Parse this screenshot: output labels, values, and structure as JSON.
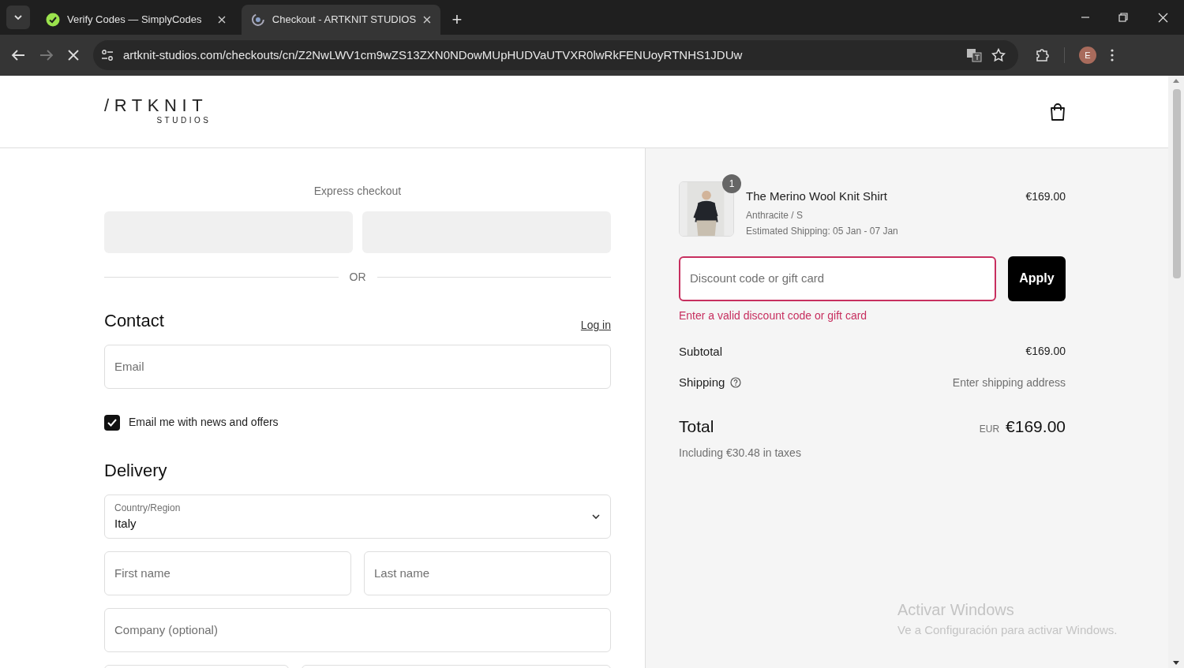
{
  "browser": {
    "tabs": [
      {
        "title": "Verify Codes — SimplyCodes",
        "selected": false,
        "kind": "check"
      },
      {
        "title": "Checkout - ARTKNIT STUDIOS",
        "selected": true,
        "kind": "loading"
      }
    ],
    "new_tab": "+",
    "address": "artknit-studios.com/checkouts/cn/Z2NwLWV1cm9wZS13ZXN0NDowMUpHUDVaUTVXR0lwRkFENUoyRTNHS1JDUw",
    "profile": "E"
  },
  "header": {
    "logo": "/RTKNIT",
    "logo_sub": "STUDIOS"
  },
  "checkout": {
    "express": {
      "title": "Express checkout",
      "divider": "OR"
    },
    "contact": {
      "title": "Contact",
      "login": "Log in",
      "email_placeholder": "Email",
      "newsletter": {
        "label": "Email me with news and offers",
        "checked": true
      }
    },
    "delivery": {
      "title": "Delivery",
      "country": {
        "label": "Country/Region",
        "value": "Italy"
      },
      "field_rows": [
        [
          "First name",
          "Last name"
        ],
        [
          "Company (optional)"
        ]
      ]
    }
  },
  "summary": {
    "item": {
      "quantity": "1",
      "name": "The Merino Wool Knit Shirt",
      "variant": "Anthracite / S",
      "shipping": "Estimated Shipping: 05 Jan - 07 Jan",
      "price": "€169.00"
    },
    "discount": {
      "placeholder": "Discount code or gift card",
      "button": "Apply",
      "error": "Enter a valid discount code or gift card"
    },
    "subtotal": {
      "label": "Subtotal",
      "value": "€169.00"
    },
    "shipping": {
      "label": "Shipping",
      "value": "Enter shipping address"
    },
    "total": {
      "label": "Total",
      "currency": "EUR",
      "value": "€169.00",
      "taxes": "Including €30.48 in taxes"
    }
  },
  "os_notice": {
    "title": "Activar Windows",
    "text": "Ve a Configuración para activar Windows."
  }
}
